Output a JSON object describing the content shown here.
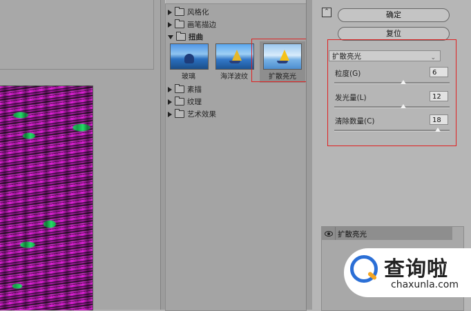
{
  "gallery": {
    "categories": [
      {
        "label": "风格化",
        "expanded": false
      },
      {
        "label": "画笔描边",
        "expanded": false
      },
      {
        "label": "扭曲",
        "expanded": true
      },
      {
        "label": "素描",
        "expanded": false
      },
      {
        "label": "纹理",
        "expanded": false
      },
      {
        "label": "艺术效果",
        "expanded": false
      }
    ],
    "filters": [
      {
        "label": "玻璃",
        "icon": "glass-filter-thumbnail"
      },
      {
        "label": "海洋波纹",
        "icon": "ocean-ripple-filter-thumbnail"
      },
      {
        "label": "扩散亮光",
        "icon": "diffuse-glow-filter-thumbnail",
        "selected": true
      }
    ]
  },
  "controls": {
    "ok_label": "确定",
    "reset_label": "复位",
    "filter_select_value": "扩散亮光",
    "params": [
      {
        "label": "粒度(G)",
        "value": "6",
        "fraction": 0.6
      },
      {
        "label": "发光量(L)",
        "value": "12",
        "fraction": 0.6
      },
      {
        "label": "清除数量(C)",
        "value": "18",
        "fraction": 0.9
      }
    ]
  },
  "layers": {
    "active_layer": "扩散亮光"
  },
  "watermark": {
    "brand_cn": "查询啦",
    "url": "chaxunla.com"
  },
  "colors": {
    "highlight_box": "#e02020",
    "preview_magenta": "#e020d8",
    "preview_green": "#22dd66"
  }
}
